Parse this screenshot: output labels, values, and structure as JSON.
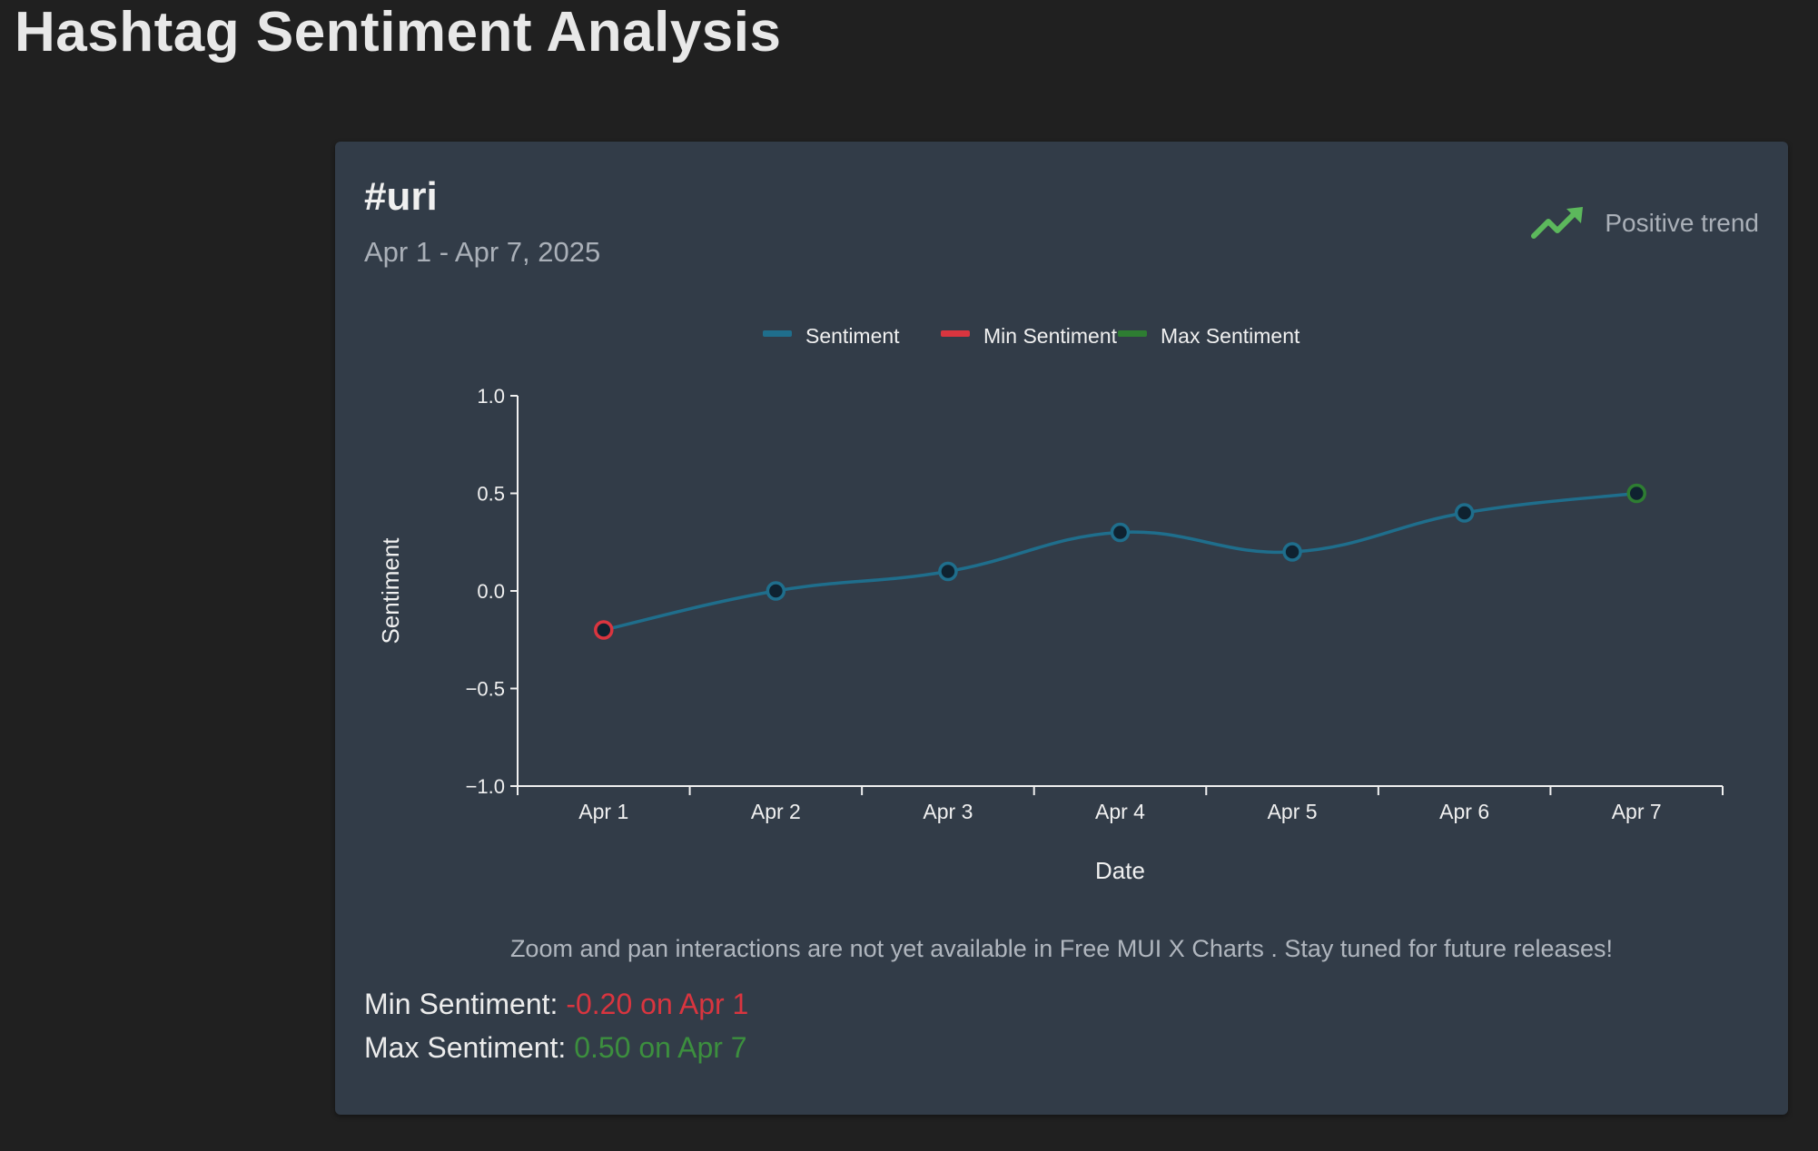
{
  "page": {
    "title": "Hashtag Sentiment Analysis"
  },
  "card": {
    "hashtag": "#uri",
    "date_range": "Apr 1 - Apr 7, 2025",
    "trend_label": "Positive trend",
    "trend_icon": "trending-up-icon",
    "trend_color": "#5cb85c",
    "zoom_note": "Zoom and pan interactions are not yet available in Free MUI X Charts . Stay tuned for future releases!",
    "min_label": "Min Sentiment:",
    "min_value_text": "-0.20 on Apr 1",
    "max_label": "Max Sentiment:",
    "max_value_text": "0.50 on Apr 7"
  },
  "chart_data": {
    "type": "line",
    "categories": [
      "Apr 1",
      "Apr 2",
      "Apr 3",
      "Apr 4",
      "Apr 5",
      "Apr 6",
      "Apr 7"
    ],
    "series": [
      {
        "name": "Sentiment",
        "values": [
          -0.2,
          0.0,
          0.1,
          0.3,
          0.2,
          0.4,
          0.5
        ],
        "color": "#1f6e8c"
      }
    ],
    "legend": [
      {
        "name": "Sentiment",
        "color": "#1f6e8c"
      },
      {
        "name": "Min Sentiment",
        "color": "#d9353f"
      },
      {
        "name": "Max Sentiment",
        "color": "#2e7d32"
      }
    ],
    "min_point": {
      "x": "Apr 1",
      "y": -0.2,
      "color": "#d9353f"
    },
    "max_point": {
      "x": "Apr 7",
      "y": 0.5,
      "color": "#2e7d32"
    },
    "xlabel": "Date",
    "ylabel": "Sentiment",
    "ylim": [
      -1.0,
      1.0
    ],
    "yticks": [
      1.0,
      0.5,
      0.0,
      -0.5,
      -1.0
    ],
    "ytick_labels": [
      "1.0",
      "0.5",
      "0.0",
      "−0.5",
      "−1.0"
    ],
    "legend_position": "top-center",
    "grid": false
  }
}
